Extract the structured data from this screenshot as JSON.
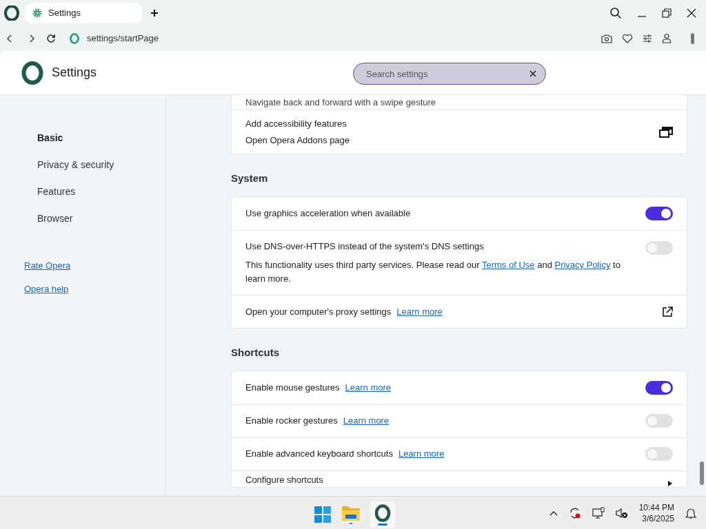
{
  "tab": {
    "title": "Settings"
  },
  "address": "settings/startPage",
  "header": {
    "title": "Settings",
    "search": {
      "placeholder": "Search settings"
    }
  },
  "sidebar": {
    "items": [
      {
        "label": "Basic",
        "selected": true
      },
      {
        "label": "Privacy & security",
        "selected": false
      },
      {
        "label": "Features",
        "selected": false
      },
      {
        "label": "Browser",
        "selected": false
      }
    ],
    "links": [
      "Rate Opera",
      "Opera help"
    ]
  },
  "sections": [
    {
      "rows": [
        {
          "kind": "text",
          "label": "Navigate back and forward with a swipe gesture"
        },
        {
          "kind": "addons",
          "label": "Add accessibility features",
          "sublabel": "Open Opera Addons page"
        }
      ]
    },
    {
      "title": "System",
      "rows": [
        {
          "kind": "toggle",
          "label": "Use graphics acceleration when available",
          "on": true
        },
        {
          "kind": "toggle",
          "label": "Use DNS-over-HTTPS instead of the system's DNS settings",
          "on": false,
          "description": [
            {
              "text": "This functionality uses third party services. Please read our "
            },
            {
              "link": "Terms of Use"
            },
            {
              "text": " and "
            },
            {
              "link": "Privacy Policy"
            },
            {
              "text": " to learn more."
            }
          ]
        },
        {
          "kind": "external",
          "label": "Open your computer's proxy settings",
          "link": "Learn more"
        }
      ]
    },
    {
      "title": "Shortcuts",
      "rows": [
        {
          "kind": "toggle",
          "label": "Enable mouse gestures",
          "link": "Learn more",
          "on": true
        },
        {
          "kind": "toggle",
          "label": "Enable rocker gestures",
          "link": "Learn more",
          "on": false
        },
        {
          "kind": "toggle",
          "label": "Enable advanced keyboard shortcuts",
          "link": "Learn more",
          "on": false
        },
        {
          "kind": "arrow",
          "label": "Configure shortcuts"
        }
      ]
    }
  ],
  "taskbar": {
    "time": "10:44 PM",
    "date": "3/6/2025"
  }
}
